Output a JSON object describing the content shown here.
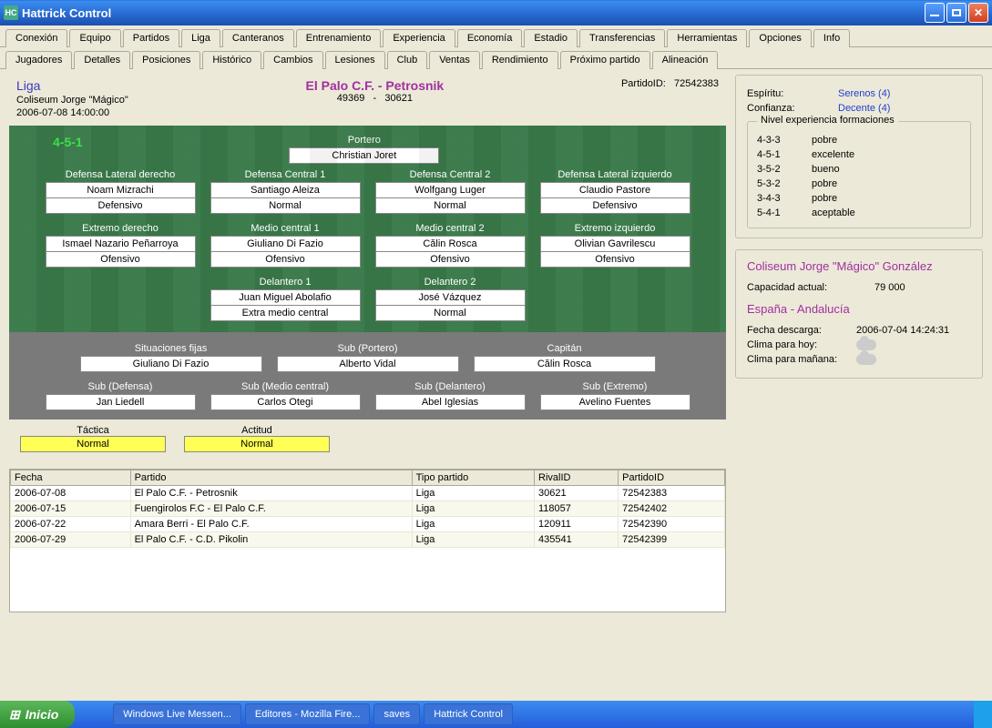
{
  "window": {
    "title": "Hattrick Control"
  },
  "mainTabs": [
    "Conexión",
    "Equipo",
    "Partidos",
    "Liga",
    "Canteranos",
    "Entrenamiento",
    "Experiencia",
    "Economía",
    "Estadio",
    "Transferencias",
    "Herramientas",
    "Opciones",
    "Info"
  ],
  "mainTabActive": 1,
  "subTabs": [
    "Jugadores",
    "Detalles",
    "Posiciones",
    "Histórico",
    "Cambios",
    "Lesiones",
    "Club",
    "Ventas",
    "Rendimiento",
    "Próximo partido",
    "Alineación"
  ],
  "subTabActive": 9,
  "header": {
    "liga": "Liga",
    "stadium": "Coliseum Jorge \"Mágico\"",
    "datetime": "2006-07-08 14:00:00",
    "matchTitle": "El Palo C.F. - Petrosnik",
    "homeId": "49369",
    "sep": "-",
    "awayId": "30621",
    "partidoIdLabel": "PartidoID:",
    "partidoId": "72542383"
  },
  "formationCode": "4-5-1",
  "lineup": {
    "gk": {
      "pos": "Portero",
      "name": "Christian Joret"
    },
    "rb": {
      "pos": "Defensa Lateral derecho",
      "name": "Noam Mizrachi",
      "order": "Defensivo"
    },
    "cb1": {
      "pos": "Defensa Central 1",
      "name": "Santiago Aleiza",
      "order": "Normal"
    },
    "cb2": {
      "pos": "Defensa Central 2",
      "name": "Wolfgang Luger",
      "order": "Normal"
    },
    "lb": {
      "pos": "Defensa Lateral izquierdo",
      "name": "Claudio Pastore",
      "order": "Defensivo"
    },
    "rw": {
      "pos": "Extremo derecho",
      "name": "Ismael Nazario Peñarroya",
      "order": "Ofensivo"
    },
    "cm1": {
      "pos": "Medio central 1",
      "name": "Giuliano Di Fazio",
      "order": "Ofensivo"
    },
    "cm2": {
      "pos": "Medio central 2",
      "name": "Călin Rosca",
      "order": "Ofensivo"
    },
    "lw": {
      "pos": "Extremo izquierdo",
      "name": "Olivian Gavrilescu",
      "order": "Ofensivo"
    },
    "fw1": {
      "pos": "Delantero 1",
      "name": "Juan Miguel Abolafio",
      "order": "Extra medio central"
    },
    "fw2": {
      "pos": "Delantero 2",
      "name": "José Vázquez",
      "order": "Normal"
    }
  },
  "subs": {
    "sp": {
      "pos": "Situaciones fijas",
      "name": "Giuliano Di Fazio"
    },
    "sgk": {
      "pos": "Sub (Portero)",
      "name": "Alberto Vidal"
    },
    "cap": {
      "pos": "Capitán",
      "name": "Călin Rosca"
    },
    "sdf": {
      "pos": "Sub (Defensa)",
      "name": "Jan Liedell"
    },
    "smc": {
      "pos": "Sub (Medio central)",
      "name": "Carlos Otegi"
    },
    "sfw": {
      "pos": "Sub (Delantero)",
      "name": "Abel Iglesias"
    },
    "sex": {
      "pos": "Sub (Extremo)",
      "name": "Avelino Fuentes"
    }
  },
  "tactic": {
    "label": "Táctica",
    "value": "Normal"
  },
  "attitude": {
    "label": "Actitud",
    "value": "Normal"
  },
  "matches": {
    "cols": [
      "Fecha",
      "Partido",
      "Tipo partido",
      "RivalID",
      "PartidoID"
    ],
    "rows": [
      [
        "2006-07-08",
        "El Palo C.F. - Petrosnik",
        "Liga",
        "30621",
        "72542383"
      ],
      [
        "2006-07-15",
        "Fuengirolos F.C - El Palo C.F.",
        "Liga",
        "118057",
        "72542402"
      ],
      [
        "2006-07-22",
        "Amara Berri - El Palo C.F.",
        "Liga",
        "120911",
        "72542390"
      ],
      [
        "2006-07-29",
        "El Palo C.F. - C.D. Pikolin",
        "Liga",
        "435541",
        "72542399"
      ]
    ]
  },
  "panel1": {
    "spiritLabel": "Espíritu:",
    "spiritValue": "Serenos (4)",
    "confLabel": "Confianza:",
    "confValue": "Decente (4)",
    "formExpTitle": "Nivel experiencia formaciones",
    "formExp": [
      {
        "k": "4-3-3",
        "v": "pobre"
      },
      {
        "k": "4-5-1",
        "v": "excelente"
      },
      {
        "k": "3-5-2",
        "v": "bueno"
      },
      {
        "k": "5-3-2",
        "v": "pobre"
      },
      {
        "k": "3-4-3",
        "v": "pobre"
      },
      {
        "k": "5-4-1",
        "v": "aceptable"
      }
    ]
  },
  "panel2": {
    "stadiumName": "Coliseum Jorge \"Mágico\" González",
    "capLabel": "Capacidad actual:",
    "capValue": "79 000",
    "region": "España - Andalucía",
    "dlLabel": "Fecha descarga:",
    "dlValue": "2006-07-04 14:24:31",
    "todayLabel": "Clima para hoy:",
    "tomLabel": "Clima para mañana:"
  },
  "taskbar": {
    "start": "Inicio",
    "items": [
      "Windows Live Messen...",
      "Editores - Mozilla Fire...",
      "saves",
      "Hattrick Control"
    ]
  }
}
